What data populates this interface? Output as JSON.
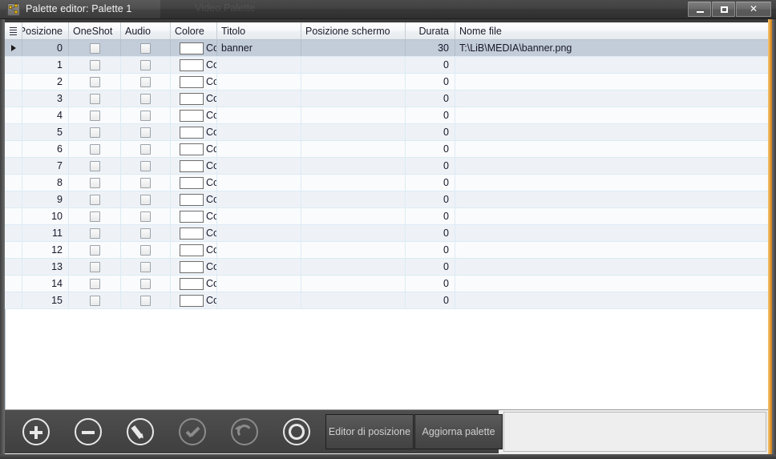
{
  "window": {
    "title": "Palette editor: Palette 1",
    "ghost_title": "Video Palette",
    "icon": "palette-node-icon",
    "controls": {
      "minimize": "minimize",
      "maximize": "maximize",
      "close": "✕"
    }
  },
  "grid": {
    "columns": [
      {
        "key": "idx",
        "label": ""
      },
      {
        "key": "pos",
        "label": "Posizione"
      },
      {
        "key": "one",
        "label": "OneShot"
      },
      {
        "key": "aud",
        "label": "Audio"
      },
      {
        "key": "col",
        "label": "Colore"
      },
      {
        "key": "tit",
        "label": "Titolo"
      },
      {
        "key": "scr",
        "label": "Posizione schermo"
      },
      {
        "key": "dur",
        "label": "Durata"
      },
      {
        "key": "file",
        "label": "Nome file"
      }
    ],
    "color_cell_label": "Col",
    "color_swatch_hex": "#ffffff",
    "rows": [
      {
        "pos": "0",
        "oneshot": false,
        "audio": false,
        "titolo": "banner",
        "posizione_schermo": "",
        "durata": "30",
        "nome_file": "T:\\LiB\\MEDIA\\banner.png",
        "selected": true
      },
      {
        "pos": "1",
        "oneshot": false,
        "audio": false,
        "titolo": "",
        "posizione_schermo": "",
        "durata": "0",
        "nome_file": "",
        "selected": false
      },
      {
        "pos": "2",
        "oneshot": false,
        "audio": false,
        "titolo": "",
        "posizione_schermo": "",
        "durata": "0",
        "nome_file": "",
        "selected": false
      },
      {
        "pos": "3",
        "oneshot": false,
        "audio": false,
        "titolo": "",
        "posizione_schermo": "",
        "durata": "0",
        "nome_file": "",
        "selected": false
      },
      {
        "pos": "4",
        "oneshot": false,
        "audio": false,
        "titolo": "",
        "posizione_schermo": "",
        "durata": "0",
        "nome_file": "",
        "selected": false
      },
      {
        "pos": "5",
        "oneshot": false,
        "audio": false,
        "titolo": "",
        "posizione_schermo": "",
        "durata": "0",
        "nome_file": "",
        "selected": false
      },
      {
        "pos": "6",
        "oneshot": false,
        "audio": false,
        "titolo": "",
        "posizione_schermo": "",
        "durata": "0",
        "nome_file": "",
        "selected": false
      },
      {
        "pos": "7",
        "oneshot": false,
        "audio": false,
        "titolo": "",
        "posizione_schermo": "",
        "durata": "0",
        "nome_file": "",
        "selected": false
      },
      {
        "pos": "8",
        "oneshot": false,
        "audio": false,
        "titolo": "",
        "posizione_schermo": "",
        "durata": "0",
        "nome_file": "",
        "selected": false
      },
      {
        "pos": "9",
        "oneshot": false,
        "audio": false,
        "titolo": "",
        "posizione_schermo": "",
        "durata": "0",
        "nome_file": "",
        "selected": false
      },
      {
        "pos": "10",
        "oneshot": false,
        "audio": false,
        "titolo": "",
        "posizione_schermo": "",
        "durata": "0",
        "nome_file": "",
        "selected": false
      },
      {
        "pos": "11",
        "oneshot": false,
        "audio": false,
        "titolo": "",
        "posizione_schermo": "",
        "durata": "0",
        "nome_file": "",
        "selected": false
      },
      {
        "pos": "12",
        "oneshot": false,
        "audio": false,
        "titolo": "",
        "posizione_schermo": "",
        "durata": "0",
        "nome_file": "",
        "selected": false
      },
      {
        "pos": "13",
        "oneshot": false,
        "audio": false,
        "titolo": "",
        "posizione_schermo": "",
        "durata": "0",
        "nome_file": "",
        "selected": false
      },
      {
        "pos": "14",
        "oneshot": false,
        "audio": false,
        "titolo": "",
        "posizione_schermo": "",
        "durata": "0",
        "nome_file": "",
        "selected": false
      },
      {
        "pos": "15",
        "oneshot": false,
        "audio": false,
        "titolo": "",
        "posizione_schermo": "",
        "durata": "0",
        "nome_file": "",
        "selected": false
      }
    ]
  },
  "toolbar": {
    "icons": [
      {
        "name": "add-icon",
        "enabled": true
      },
      {
        "name": "remove-icon",
        "enabled": true
      },
      {
        "name": "edit-icon",
        "enabled": true
      },
      {
        "name": "confirm-icon",
        "enabled": false
      },
      {
        "name": "undo-icon",
        "enabled": false
      },
      {
        "name": "refresh-icon",
        "enabled": true
      }
    ],
    "posizione_label": "Editor di posizione",
    "aggiorna_label": "Aggiorna palette"
  },
  "colors": {
    "accent_border": "#e8a23c",
    "titlebar": "#3f3f3f",
    "toolbar_dark": "#474747",
    "selected_row": "#c3ccd9",
    "row_odd": "#fafbfc",
    "row_even": "#eef2f6"
  }
}
